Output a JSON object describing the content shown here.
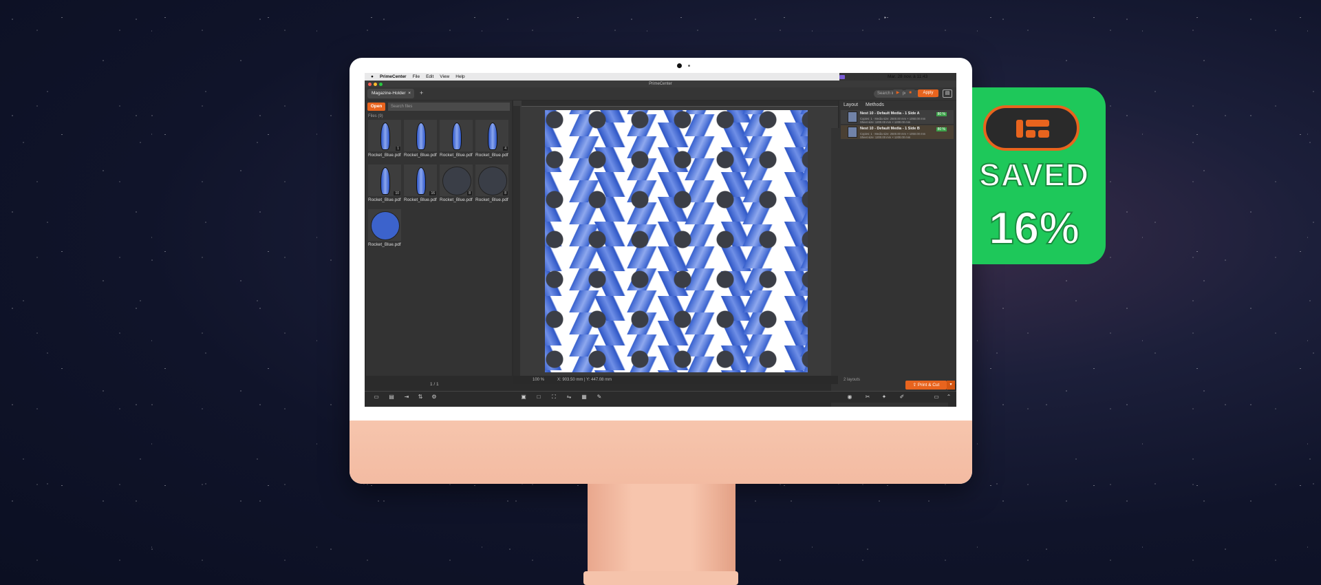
{
  "menubar": {
    "app": "PrimeCenter",
    "items": [
      "File",
      "Edit",
      "View",
      "Help"
    ],
    "clock": "Mar. 28 nov. à 11:43"
  },
  "window": {
    "title": "PrimeCenter"
  },
  "tabs": [
    {
      "label": "Magazine-Holder",
      "close": "×"
    }
  ],
  "new_tab": "+",
  "recipes_search": {
    "placeholder": "Search in recipes list"
  },
  "left": {
    "open_label": "Open",
    "search_placeholder": "Search files",
    "files_count": "Files (9)",
    "files": [
      {
        "name": "Rocket_Blue.pdf",
        "badge": "1"
      },
      {
        "name": "Rocket_Blue.pdf",
        "badge": ""
      },
      {
        "name": "Rocket_Blue.pdf",
        "badge": ""
      },
      {
        "name": "Rocket_Blue.pdf",
        "badge": "4"
      },
      {
        "name": "Rocket_Blue.pdf",
        "badge": "10"
      },
      {
        "name": "Rocket_Blue.pdf",
        "badge": "16"
      },
      {
        "name": "Rocket_Blue.pdf",
        "badge": "8"
      },
      {
        "name": "Rocket_Blue.pdf",
        "badge": "8"
      },
      {
        "name": "Rocket_Blue.pdf",
        "badge": ""
      }
    ],
    "pager": "1 / 1"
  },
  "status": {
    "zoom": "100 %",
    "coords": "X: 903.50 mm | Y: 447.08 mm"
  },
  "right": {
    "tabs": [
      "Layout",
      "Methods"
    ],
    "nests": [
      {
        "name": "Nest 10 - Default Media - 1 Side A",
        "meta1": "Copies: 1 · Media size: 2500.00 mm × 1050.00 mm",
        "meta2": "Sheet size: 1200.00 mm × 1200.00 mm",
        "pct": "80 %"
      },
      {
        "name": "Nest 10 - Default Media - 1 Side B",
        "meta1": "Copies: 1 · Media size: 2500.00 mm × 1050.00 mm",
        "meta2": "Sheet size: 1200.00 mm × 1200.00 mm",
        "pct": "80 %"
      }
    ],
    "layouts_count": "2 layouts",
    "print_label": "⇪ Print & Cut",
    "apply_label": "Apply"
  },
  "badge": {
    "line1": "SAVED",
    "line2": "16%"
  },
  "colors": {
    "accent": "#e8641e",
    "badge_green": "#1ec85a"
  }
}
